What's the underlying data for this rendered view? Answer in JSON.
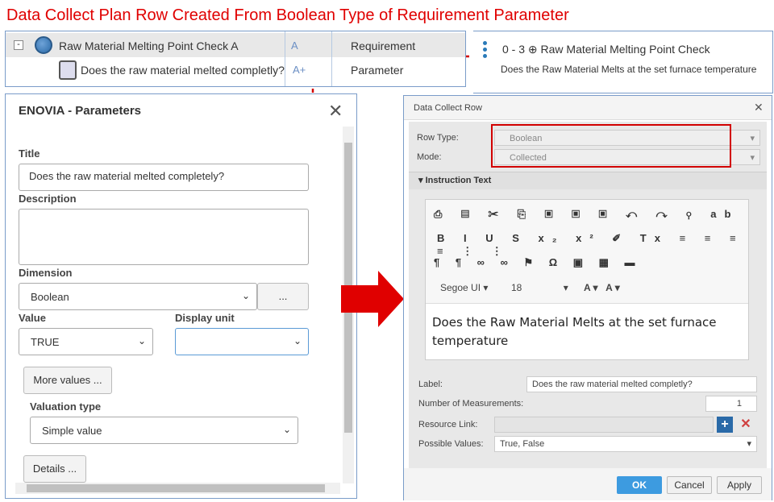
{
  "page_title": "Data Collect Plan Row Created From Boolean Type of Requirement Parameter",
  "tree": {
    "row1": {
      "toggle": "-",
      "name": "Raw Material Melting Point Check A",
      "type": "Requirement"
    },
    "row2": {
      "name": "Does the raw material melted completly?",
      "type": "Parameter"
    }
  },
  "info": {
    "title": "0 - 3 ⊕ Raw Material Melting Point Check",
    "desc": "Does the Raw Material Melts at the set furnace temperature"
  },
  "params": {
    "header": "ENOVIA - Parameters",
    "title_label": "Title",
    "title_value": "Does the raw material melted completely?",
    "description_label": "Description",
    "dimension_label": "Dimension",
    "dimension_value": "Boolean",
    "dimension_btn": "...",
    "value_label": "Value",
    "value_value": "TRUE",
    "display_unit_label": "Display unit",
    "more_values": "More values ...",
    "valuation_label": "Valuation type",
    "valuation_value": "Simple value",
    "details": "Details ..."
  },
  "dcr": {
    "header": "Data Collect Row",
    "row_type_label": "Row Type:",
    "row_type_value": "Boolean",
    "mode_label": "Mode:",
    "mode_value": "Collected",
    "section": "Instruction Text",
    "font_name": "Segoe UI",
    "font_size": "18",
    "editor_text": "Does the Raw Material Melts at the set furnace temperature",
    "label_label": "Label:",
    "label_value": "Does the raw material melted completly?",
    "num_label": "Number of Measurements:",
    "num_value": "1",
    "resource_label": "Resource Link:",
    "possible_label": "Possible Values:",
    "possible_value": "True, False",
    "ok": "OK",
    "cancel": "Cancel",
    "apply": "Apply"
  },
  "colors": {
    "accent_red": "#d20000",
    "ok_blue": "#3d9be0",
    "border_blue": "#7a9cc9"
  }
}
